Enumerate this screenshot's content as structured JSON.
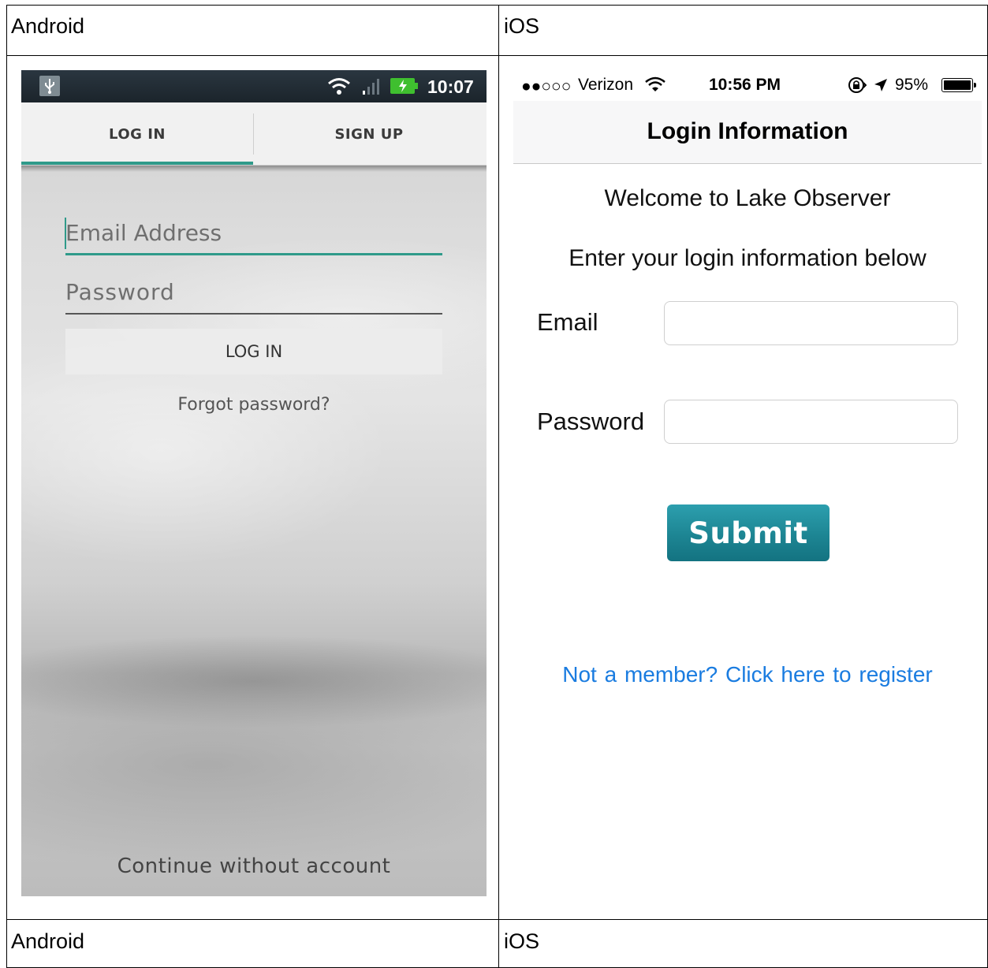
{
  "table": {
    "top_left_label": "Android",
    "top_right_label": "iOS",
    "bottom_left_label": "Android",
    "bottom_right_label": "iOS"
  },
  "android": {
    "status_bar": {
      "time": "10:07",
      "icons": [
        "usb-icon",
        "wifi-icon",
        "signal-icon",
        "battery-charging-icon"
      ]
    },
    "tabs": [
      {
        "label": "LOG IN",
        "selected": true
      },
      {
        "label": "SIGN UP",
        "selected": false
      }
    ],
    "email_placeholder": "Email Address",
    "password_placeholder": "Password",
    "login_button": "LOG IN",
    "forgot_password": "Forgot password?",
    "continue_without_account": "Continue without account",
    "accent_color": "#2f9a8a"
  },
  "ios": {
    "status_bar": {
      "signal_dots": "●●○○○",
      "carrier": "Verizon",
      "time": "10:56 PM",
      "battery_percent": "95%",
      "icons": [
        "wifi-icon",
        "rotation-lock-icon",
        "location-arrow-icon",
        "battery-icon"
      ]
    },
    "nav_title": "Login Information",
    "welcome": "Welcome to Lake Observer",
    "instructions": "Enter your login information below",
    "email_label": "Email",
    "password_label": "Password",
    "submit_button": "Submit",
    "register_link": "Not a member?  Click here to register",
    "submit_color": "#1d8593",
    "link_color": "#1a7ce0"
  }
}
